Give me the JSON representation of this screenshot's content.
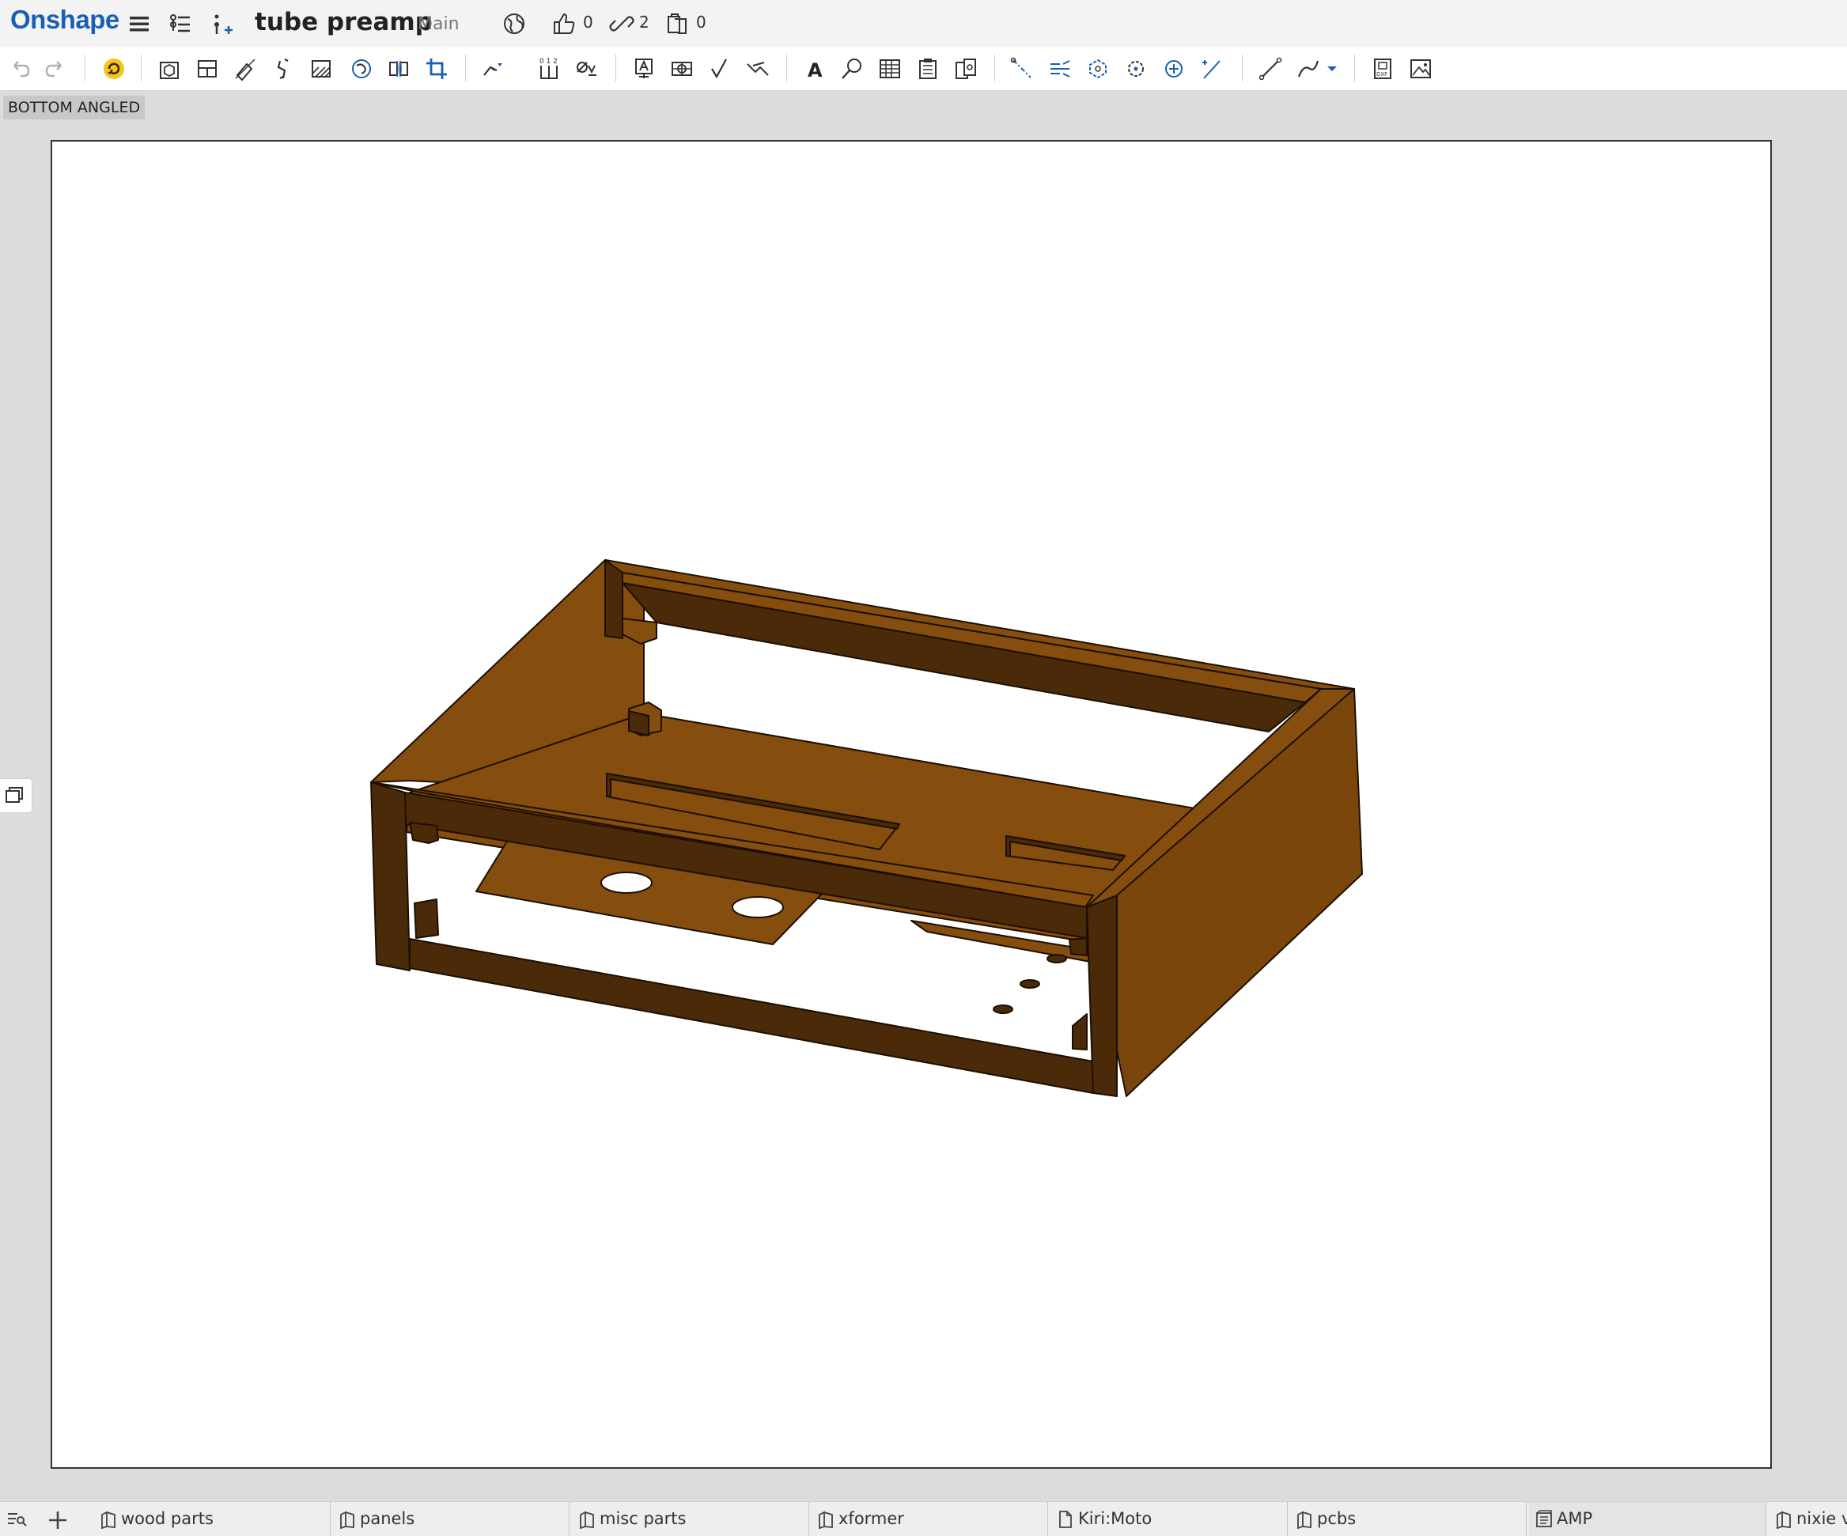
{
  "header": {
    "logo": "Onshape",
    "document_title": "tube preamp",
    "workspace": "Main",
    "likes": "0",
    "links": "2",
    "copies": "0"
  },
  "toolbar": {
    "tools": [
      "undo-icon",
      "redo-icon",
      "update-icon",
      "insert-view-icon",
      "projected-view-icon",
      "auxiliary-view-icon",
      "section-view-icon",
      "detail-view-icon",
      "broken-out-section-icon",
      "break-view-icon",
      "crop-view-icon",
      "dimension-icon",
      "ordinate-dimension-icon",
      "hole-callout-icon",
      "note-icon",
      "datum-icon",
      "surface-finish-icon",
      "weld-symbol-icon",
      "text-icon",
      "callout-icon",
      "table-icon",
      "bom-icon",
      "hole-table-icon",
      "centerline-icon",
      "center-mark-icon",
      "circular-centerline-icon",
      "point-icon",
      "leader-icon",
      "line-icon",
      "spline-icon",
      "export-dxf-icon",
      "export-image-icon"
    ]
  },
  "view": {
    "label": "BOTTOM ANGLED"
  },
  "tabs": [
    {
      "label": "wood parts",
      "icon": "part-studio-icon"
    },
    {
      "label": "panels",
      "icon": "part-studio-icon"
    },
    {
      "label": "misc parts",
      "icon": "part-studio-icon"
    },
    {
      "label": "xformer",
      "icon": "part-studio-icon"
    },
    {
      "label": "Kiri:Moto",
      "icon": "document-icon"
    },
    {
      "label": "pcbs",
      "icon": "part-studio-icon"
    },
    {
      "label": "AMP",
      "icon": "drawing-icon"
    },
    {
      "label": "nixie v",
      "icon": "part-studio-icon"
    }
  ],
  "colors": {
    "logo": "#1a5fb4",
    "wood_light": "#854d0e",
    "wood_mid": "#7a460c",
    "wood_dark": "#4a2a08",
    "update_accent": "#f5c518"
  }
}
